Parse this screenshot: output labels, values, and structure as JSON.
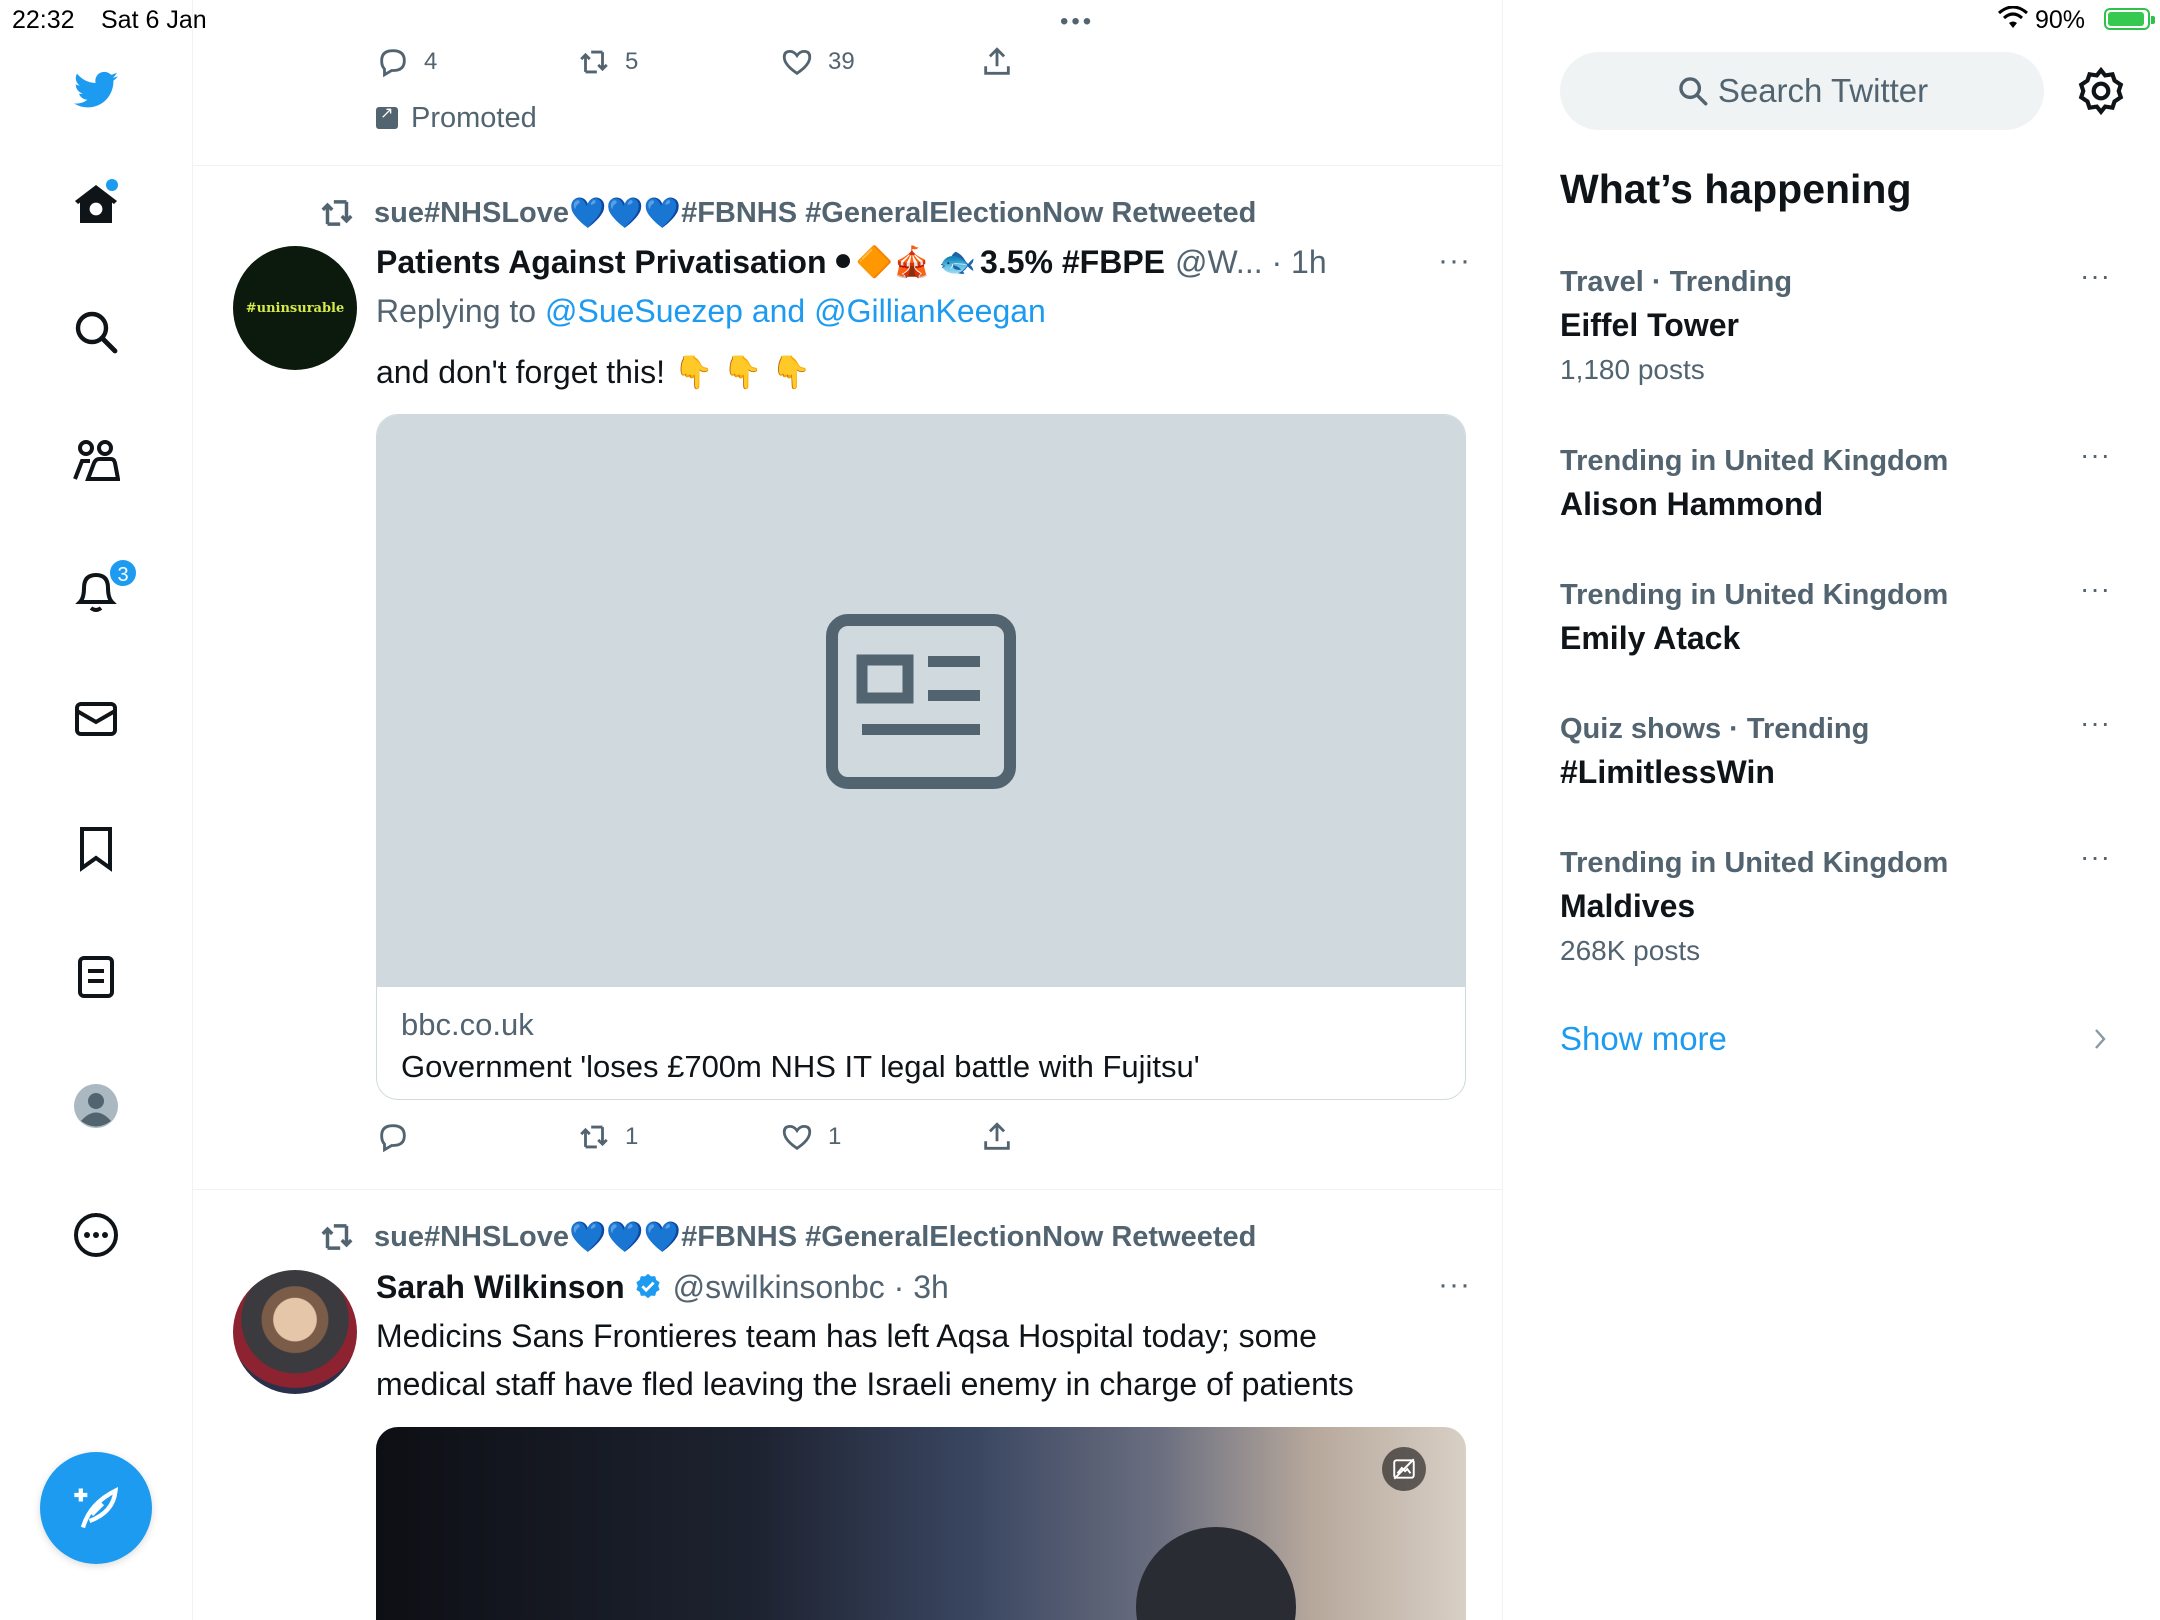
{
  "status": {
    "time": "22:32",
    "date": "Sat 6 Jan",
    "battery": "90%"
  },
  "nav": {
    "items": [
      "home",
      "explore",
      "communities",
      "notifications",
      "messages",
      "bookmarks",
      "lists",
      "profile",
      "more"
    ],
    "notification_count": "3"
  },
  "promo_tweet": {
    "replies": "4",
    "retweets": "5",
    "likes": "39",
    "promoted_label": "Promoted"
  },
  "tweet1": {
    "retweeted_by": "sue#NHSLove",
    "retweeted_by_tail": "#FBNHS #GeneralElectionNow Retweeted",
    "retweeted_hearts": "💙💙💙",
    "avatar_text": "#uninsurable",
    "name": "Patients Against Privatisation",
    "name_emojis": "⚫🔶🎪 🐟",
    "name_tail": "3.5% #FBPE",
    "handle_time": "@W... · 1h",
    "replying_to_label": "Replying to ",
    "replying_to_mentions": "@SueSuezep and @GillianKeegan",
    "text": "and don't forget this!  👇 👇 👇",
    "card_domain": "bbc.co.uk",
    "card_title": "Government 'loses £700m NHS IT legal battle with Fujitsu'",
    "replies": "",
    "retweets": "1",
    "likes": "1"
  },
  "tweet2": {
    "retweeted_by": "sue#NHSLove",
    "retweeted_by_tail": "#FBNHS #GeneralElectionNow Retweeted",
    "retweeted_hearts": "💙💙💙",
    "name": "Sarah Wilkinson",
    "handle_time": "@swilkinsonbc · 3h",
    "text_line1": "Medicins Sans Frontieres team has left Aqsa Hospital today; some",
    "text_line2": "medical staff have fled leaving the Israeli enemy in charge of patients"
  },
  "sidebar": {
    "search_placeholder": "Search Twitter",
    "title": "What’s happening",
    "trends": [
      {
        "context": "Travel · Trending",
        "name": "Eiffel Tower",
        "posts": "1,180 posts"
      },
      {
        "context": "Trending in United Kingdom",
        "name": "Alison Hammond",
        "posts": ""
      },
      {
        "context": "Trending in United Kingdom",
        "name": "Emily Atack",
        "posts": ""
      },
      {
        "context": "Quiz shows · Trending",
        "name": "#LimitlessWin",
        "posts": ""
      },
      {
        "context": "Trending in United Kingdom",
        "name": "Maldives",
        "posts": "268K posts"
      }
    ],
    "show_more": "Show more"
  },
  "colors": {
    "accent": "#1d9bf0",
    "text": "#0f1419",
    "secondary": "#536471",
    "border": "#eff3f4"
  }
}
